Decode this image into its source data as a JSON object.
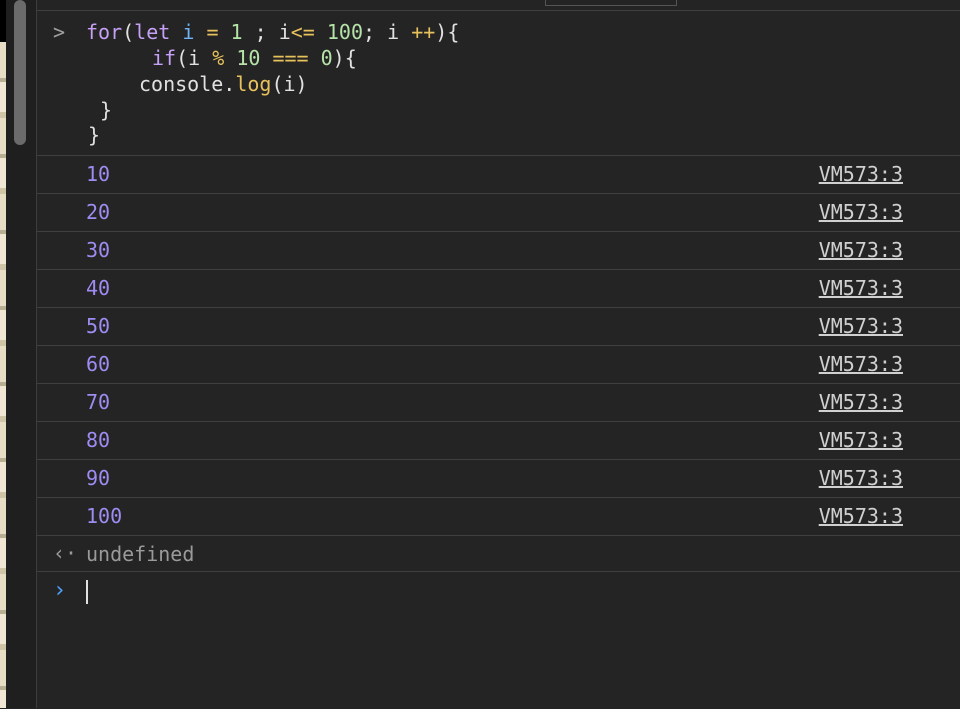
{
  "console": {
    "input_prompt": ">",
    "code_lines": [
      [
        "for",
        "(",
        "let",
        " ",
        "i",
        " ",
        "=",
        " ",
        "1",
        " ; i",
        "<=",
        " ",
        "100",
        "; i ",
        "++",
        ")",
        ")",
        "{"
      ],
      [],
      [],
      [],
      []
    ],
    "code": {
      "line1": {
        "t1": "for",
        "t2": "(",
        "t3": "let",
        "t4": " ",
        "t5": "i",
        "t6": " ",
        "t7": "=",
        "t8": " ",
        "t9": "1",
        "t10": " ; i",
        "t11": "<=",
        "t12": " ",
        "t13": "100",
        "t14": "; i ",
        "t15": "++",
        "t16": "){"
      },
      "line2": {
        "t1": "if",
        "t2": "(i ",
        "t3": "%",
        "t4": " ",
        "t5": "10",
        "t6": " ",
        "t7": "===",
        "t8": " ",
        "t9": "0",
        "t10": "){"
      },
      "line3": {
        "t1": "console.",
        "t2": "log",
        "t3": "(i)"
      },
      "line4": "}",
      "line5": "}"
    },
    "logs": [
      {
        "value": "10",
        "source": "VM573:3"
      },
      {
        "value": "20",
        "source": "VM573:3"
      },
      {
        "value": "30",
        "source": "VM573:3"
      },
      {
        "value": "40",
        "source": "VM573:3"
      },
      {
        "value": "50",
        "source": "VM573:3"
      },
      {
        "value": "60",
        "source": "VM573:3"
      },
      {
        "value": "70",
        "source": "VM573:3"
      },
      {
        "value": "80",
        "source": "VM573:3"
      },
      {
        "value": "90",
        "source": "VM573:3"
      },
      {
        "value": "100",
        "source": "VM573:3"
      }
    ],
    "result": {
      "icon": "result-arrow-icon",
      "glyph": "‹·",
      "value": "undefined"
    },
    "prompt": {
      "icon": "chevron-right-icon",
      "glyph": "›",
      "value": ""
    }
  },
  "colors": {
    "background": "#242424",
    "log_value": "#9f8cf2",
    "prompt_accent": "#4da3ff",
    "keyword": "#c6a0f6",
    "variable": "#6fb3f7",
    "operator": "#e6c15c",
    "number": "#b5e3a8"
  }
}
